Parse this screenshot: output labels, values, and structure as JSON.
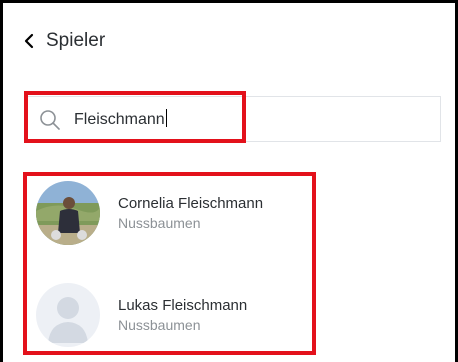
{
  "header": {
    "title": "Spieler",
    "back_icon": "chevron-left-icon"
  },
  "search": {
    "value": "Fleischmann",
    "icon": "search-icon"
  },
  "results": [
    {
      "name": "Cornelia Fleischmann",
      "club": "Nussbaumen",
      "avatar": "photo"
    },
    {
      "name": "Lukas Fleischmann",
      "club": "Nussbaumen",
      "avatar": "placeholder"
    }
  ],
  "colors": {
    "highlight": "#e3111b",
    "text": "#2b2f33",
    "subtext": "#8c9196"
  }
}
